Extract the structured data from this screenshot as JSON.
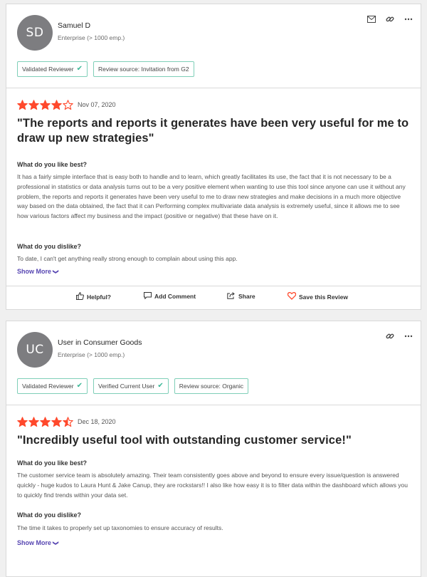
{
  "reviews": [
    {
      "initials": "SD",
      "name": "Samuel D",
      "company_size": "Enterprise (> 1000 emp.)",
      "badges": [
        "Validated Reviewer",
        "Review source: Invitation from G2"
      ],
      "rating": 4,
      "date": "Nov 07, 2020",
      "title": "\"The reports and reports it generates have been very useful for me to draw up new strategies\"",
      "like_label": "What do you like best?",
      "like_text": "It has a fairly simple interface that is easy both to handle and to learn, which greatly facilitates its use, the fact that it is not necessary to be a professional in statistics or data analysis turns out to be a very positive element when wanting to use this tool since anyone can use it without any problem, the reports and reports it generates have been very useful to me to draw new strategies and make decisions in a much more objective way based on the data obtained, the fact that it can Performing complex multivariate data analysis is extremely useful, since it allows me to see how various factors affect my business and the impact (positive or negative) that these have on it.",
      "dislike_label": "What do you dislike?",
      "dislike_text": "To date, I can't get anything really strong enough to complain about using this app.",
      "show_more": "Show More",
      "actions": {
        "helpful": "Helpful?",
        "comment": "Add Comment",
        "share": "Share",
        "save": "Save this Review"
      }
    },
    {
      "initials": "UC",
      "name": "User in Consumer Goods",
      "company_size": "Enterprise (> 1000 emp.)",
      "badges": [
        "Validated Reviewer",
        "Verified Current User",
        "Review source: Organic"
      ],
      "rating": 4.5,
      "date": "Dec 18, 2020",
      "title": "\"Incredibly useful tool with outstanding customer service!\"",
      "like_label": "What do you like best?",
      "like_text": "The customer service team is absolutely amazing. Their team consistently goes above and beyond to ensure every issue/question is answered quickly - huge kudos to Laura Hunt & Jake Canup, they are rockstars!! I also like how easy it is to filter data within the dashboard which allows you to quickly find trends within your data set.",
      "dislike_label": "What do you dislike?",
      "dislike_text": "The time it takes to properly set up taxonomies to ensure accuracy of results.",
      "show_more": "Show More"
    }
  ],
  "colors": {
    "star": "#ff492c",
    "badge_border": "#7fcfb8",
    "check": "#3ab796",
    "link": "#5746b2"
  }
}
